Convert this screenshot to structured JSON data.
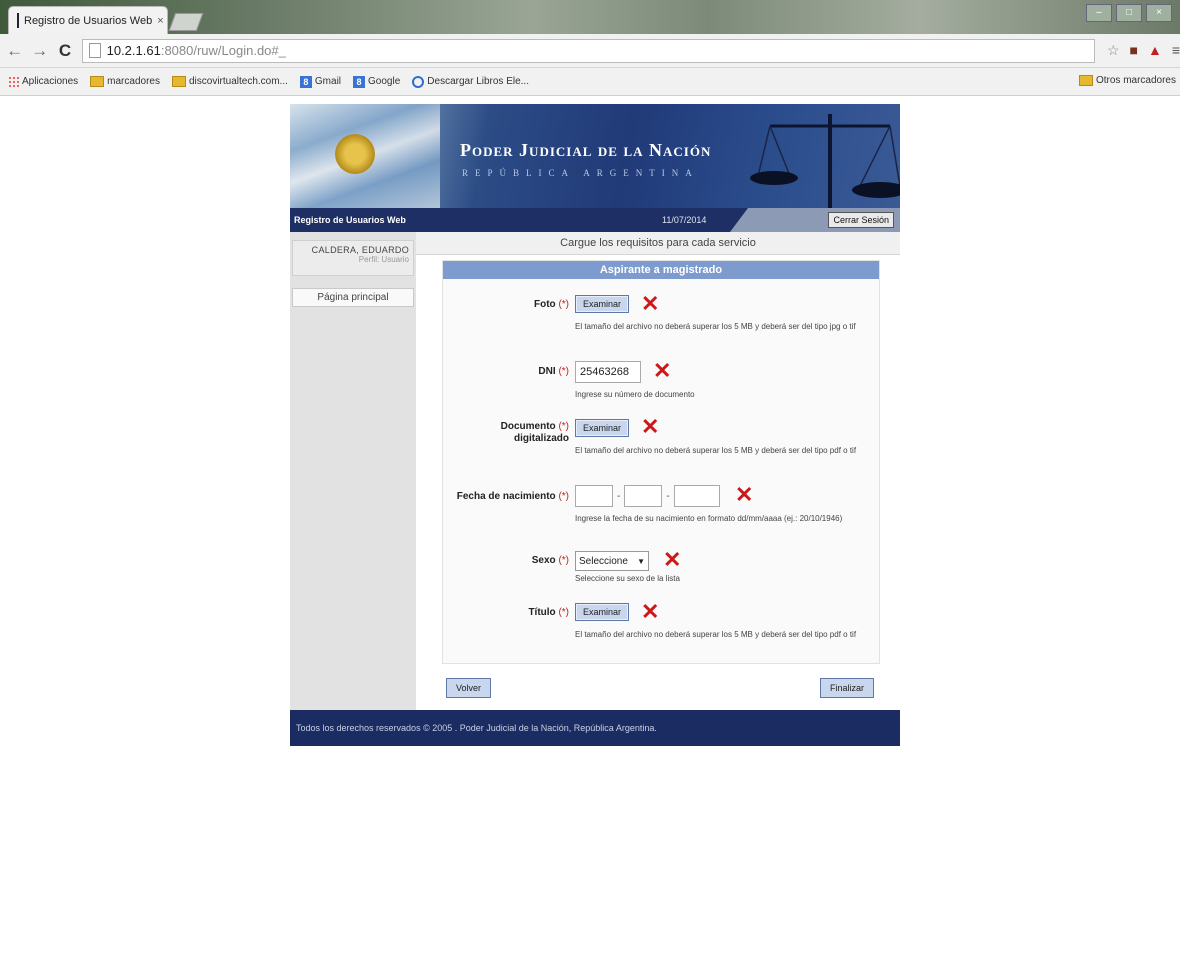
{
  "browser": {
    "tab_title": "Registro de Usuarios Web",
    "tab_close": "×",
    "url_host": "10.2.1.61",
    "url_rest": ":8080/ruw/Login.do#_",
    "window_controls": [
      "–",
      "□",
      "×"
    ],
    "icons": [
      "star-icon",
      "extension-icon",
      "pdf-icon",
      "menu-icon"
    ]
  },
  "bookmarks": {
    "items": [
      {
        "label": "Aplicaciones",
        "icon": "apps-icon"
      },
      {
        "label": "marcadores",
        "icon": "folder-icon"
      },
      {
        "label": "discovirtualtech.com...",
        "icon": "folder-icon"
      },
      {
        "label": "Gmail",
        "icon": "g-icon"
      },
      {
        "label": "Google",
        "icon": "g-icon"
      },
      {
        "label": "Descargar Libros Ele...",
        "icon": "globe-icon"
      }
    ],
    "other": "Otros marcadores"
  },
  "banner": {
    "title": "Poder Judicial de la Nación",
    "subtitle": "REPÚBLICA ARGENTINA"
  },
  "subbar": {
    "app_name": "Registro de Usuarios Web",
    "date": "11/07/2014",
    "logout": "Cerrar Sesión"
  },
  "sidebar": {
    "user_name": "CALDERA, EDUARDO",
    "user_profile": "Perfil: Usuario",
    "home": "Página principal"
  },
  "main": {
    "heading": "Cargue los requisitos para cada servicio",
    "form_title": "Aspirante a magistrado",
    "required_mark": "(*)",
    "fields": {
      "foto": {
        "label": "Foto",
        "button": "Examinar",
        "hint": "El tamaño del archivo no deberá superar los 5 MB y deberá ser del tipo jpg o tif"
      },
      "dni": {
        "label": "DNI",
        "value": "25463268",
        "hint": "Ingrese su número de documento"
      },
      "documento": {
        "label_line1": "Documento",
        "label_line2": "digitalizado",
        "button": "Examinar",
        "hint": "El tamaño del archivo no deberá superar los 5 MB y deberá ser del tipo pdf o tif"
      },
      "fecha": {
        "label": "Fecha de nacimiento",
        "separator": "-",
        "hint": "Ingrese la fecha de su nacimiento en formato dd/mm/aaaa (ej.: 20/10/1946)"
      },
      "sexo": {
        "label": "Sexo",
        "selected": "Seleccione",
        "hint": "Seleccione su sexo de la lista"
      },
      "titulo": {
        "label": "Título",
        "button": "Examinar",
        "hint": "El tamaño del archivo no deberá superar los 5 MB y deberá ser del tipo pdf o tif"
      }
    },
    "invalid_mark": "✕",
    "back_button": "Volver",
    "finish_button": "Finalizar"
  },
  "footer": {
    "text": "Todos los derechos reservados © 2005 . Poder Judicial de la Nación, República Argentina."
  },
  "colors": {
    "header_dark": "#1d2f64",
    "form_title_bg": "#7e9bd0",
    "error_red": "#cc1818"
  }
}
